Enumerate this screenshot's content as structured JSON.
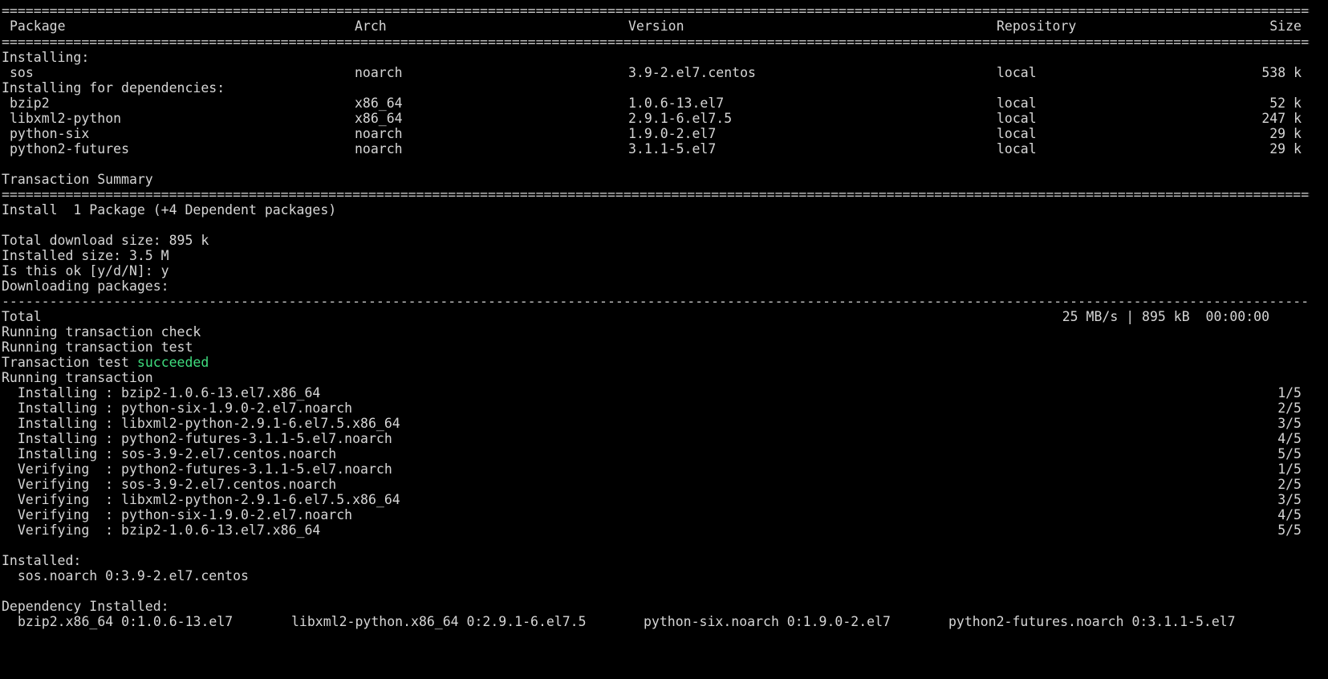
{
  "header": {
    "package": "Package",
    "arch": "Arch",
    "version": "Version",
    "repository": "Repository",
    "size": "Size"
  },
  "installing_label": "Installing:",
  "installing": [
    {
      "package": "sos",
      "arch": "noarch",
      "version": "3.9-2.el7.centos",
      "repository": "local",
      "size": "538 k"
    }
  ],
  "dependencies_label": "Installing for dependencies:",
  "dependencies": [
    {
      "package": "bzip2",
      "arch": "x86_64",
      "version": "1.0.6-13.el7",
      "repository": "local",
      "size": "52 k"
    },
    {
      "package": "libxml2-python",
      "arch": "x86_64",
      "version": "2.9.1-6.el7.5",
      "repository": "local",
      "size": "247 k"
    },
    {
      "package": "python-six",
      "arch": "noarch",
      "version": "1.9.0-2.el7",
      "repository": "local",
      "size": "29 k"
    },
    {
      "package": "python2-futures",
      "arch": "noarch",
      "version": "3.1.1-5.el7",
      "repository": "local",
      "size": "29 k"
    }
  ],
  "summary": {
    "title": "Transaction Summary",
    "install_line": "Install  1 Package (+4 Dependent packages)",
    "download_size": "Total download size: 895 k",
    "installed_size": "Installed size: 3.5 M",
    "prompt": "Is this ok [y/d/N]: y",
    "downloading": "Downloading packages:"
  },
  "total": {
    "label": "Total",
    "stats": "25 MB/s | 895 kB  00:00:00"
  },
  "run_check": "Running transaction check",
  "run_test": "Running transaction test",
  "test_result_prefix": "Transaction test ",
  "test_result_status": "succeeded",
  "run_transaction": "Running transaction",
  "steps": [
    {
      "action": "  Installing : bzip2-1.0.6-13.el7.x86_64",
      "progress": "1/5"
    },
    {
      "action": "  Installing : python-six-1.9.0-2.el7.noarch",
      "progress": "2/5"
    },
    {
      "action": "  Installing : libxml2-python-2.9.1-6.el7.5.x86_64",
      "progress": "3/5"
    },
    {
      "action": "  Installing : python2-futures-3.1.1-5.el7.noarch",
      "progress": "4/5"
    },
    {
      "action": "  Installing : sos-3.9-2.el7.centos.noarch",
      "progress": "5/5"
    },
    {
      "action": "  Verifying  : python2-futures-3.1.1-5.el7.noarch",
      "progress": "1/5"
    },
    {
      "action": "  Verifying  : sos-3.9-2.el7.centos.noarch",
      "progress": "2/5"
    },
    {
      "action": "  Verifying  : libxml2-python-2.9.1-6.el7.5.x86_64",
      "progress": "3/5"
    },
    {
      "action": "  Verifying  : python-six-1.9.0-2.el7.noarch",
      "progress": "4/5"
    },
    {
      "action": "  Verifying  : bzip2-1.0.6-13.el7.x86_64",
      "progress": "5/5"
    }
  ],
  "installed_label": "Installed:",
  "installed_item": "  sos.noarch 0:3.9-2.el7.centos",
  "dep_installed_label": "Dependency Installed:",
  "dep_installed": [
    "bzip2.x86_64 0:1.0.6-13.el7",
    "libxml2-python.x86_64 0:2.9.1-6.el7.5",
    "python-six.noarch 0:1.9.0-2.el7",
    "python2-futures.noarch 0:3.1.1-5.el7"
  ],
  "colors": {
    "background": "#000000",
    "text": "#d6d6d6",
    "success": "#3fdc7e"
  }
}
